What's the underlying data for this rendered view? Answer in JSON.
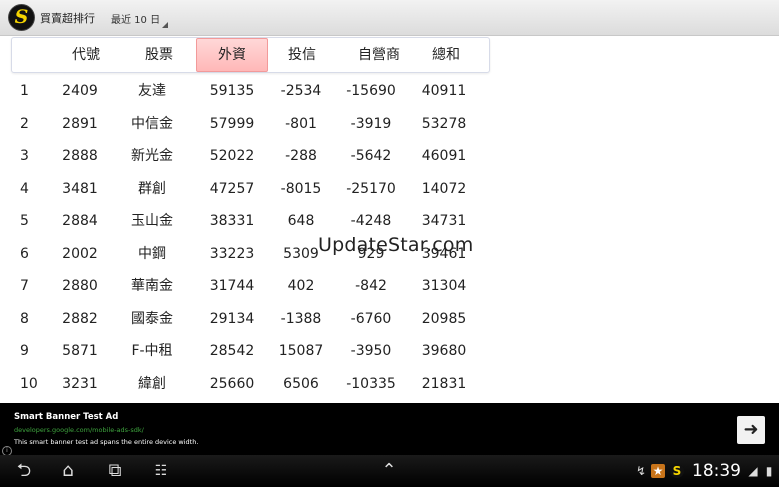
{
  "actionbar": {
    "title": "買賣超排行",
    "spinner_value": "最近 10 日"
  },
  "table": {
    "headers": [
      "代號",
      "股票",
      "外資",
      "投信",
      "自營商",
      "總和"
    ],
    "active_header": "外資",
    "rows": [
      {
        "rank": "1",
        "code": "2409",
        "name": "友達",
        "foreign": "59135",
        "trust": "-2534",
        "dealer": "-15690",
        "total": "40911"
      },
      {
        "rank": "2",
        "code": "2891",
        "name": "中信金",
        "foreign": "57999",
        "trust": "-801",
        "dealer": "-3919",
        "total": "53278"
      },
      {
        "rank": "3",
        "code": "2888",
        "name": "新光金",
        "foreign": "52022",
        "trust": "-288",
        "dealer": "-5642",
        "total": "46091"
      },
      {
        "rank": "4",
        "code": "3481",
        "name": "群創",
        "foreign": "47257",
        "trust": "-8015",
        "dealer": "-25170",
        "total": "14072"
      },
      {
        "rank": "5",
        "code": "2884",
        "name": "玉山金",
        "foreign": "38331",
        "trust": "648",
        "dealer": "-4248",
        "total": "34731"
      },
      {
        "rank": "6",
        "code": "2002",
        "name": "中鋼",
        "foreign": "33223",
        "trust": "5309",
        "dealer": "929",
        "total": "39461"
      },
      {
        "rank": "7",
        "code": "2880",
        "name": "華南金",
        "foreign": "31744",
        "trust": "402",
        "dealer": "-842",
        "total": "31304"
      },
      {
        "rank": "8",
        "code": "2882",
        "name": "國泰金",
        "foreign": "29134",
        "trust": "-1388",
        "dealer": "-6760",
        "total": "20985"
      },
      {
        "rank": "9",
        "code": "5871",
        "name": "F-中租",
        "foreign": "28542",
        "trust": "15087",
        "dealer": "-3950",
        "total": "39680"
      },
      {
        "rank": "10",
        "code": "3231",
        "name": "緯創",
        "foreign": "25660",
        "trust": "6506",
        "dealer": "-10335",
        "total": "21831"
      }
    ]
  },
  "watermark": "UpdateStar.com",
  "ad": {
    "title": "Smart Banner Test Ad",
    "url": "developers.google.com/mobile-ads-sdk/",
    "description": "This smart banner test ad spans the entire device width.",
    "button_icon": "arrow-right-icon"
  },
  "systembar": {
    "time": "18:39"
  }
}
